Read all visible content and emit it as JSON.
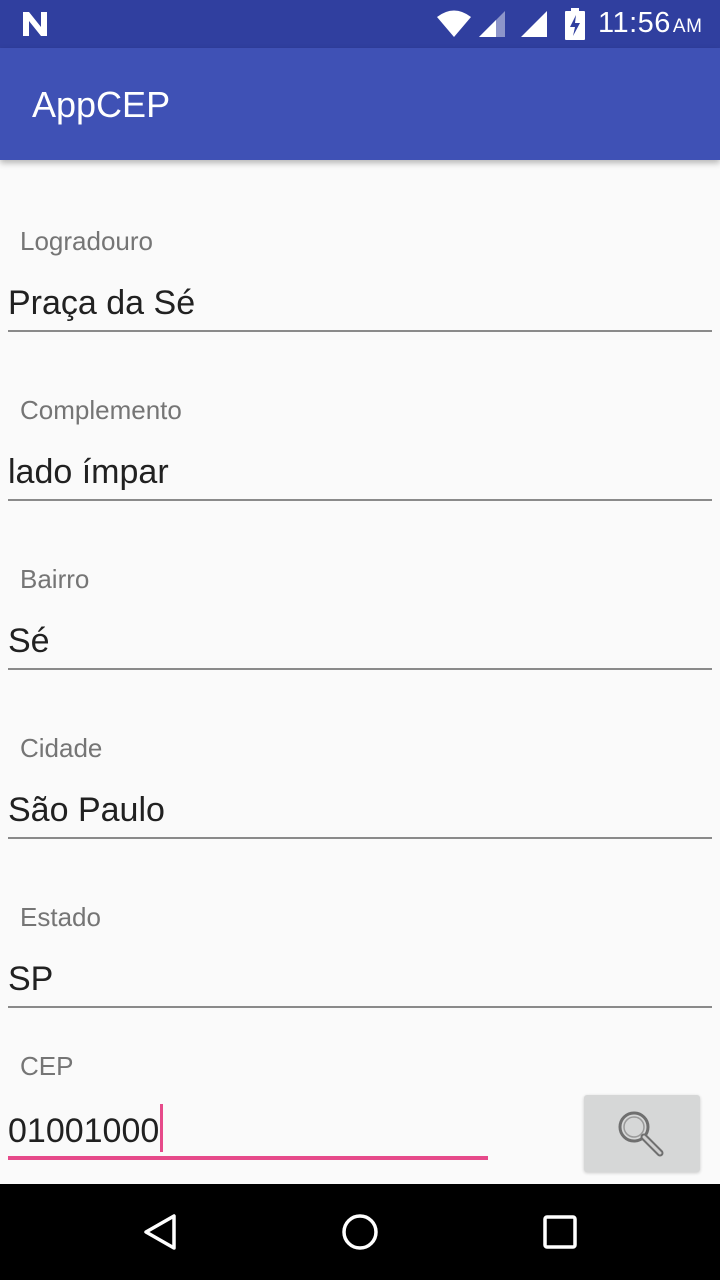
{
  "status_bar": {
    "time": "11:56",
    "ampm": "AM",
    "icons": [
      "n-icon",
      "wifi-icon",
      "signal-icon",
      "signal-icon",
      "battery-charging-icon"
    ]
  },
  "app_bar": {
    "title": "AppCEP"
  },
  "form": {
    "fields": [
      {
        "label": "Logradouro",
        "value": "Praça da Sé"
      },
      {
        "label": "Complemento",
        "value": "lado ímpar"
      },
      {
        "label": "Bairro",
        "value": "Sé"
      },
      {
        "label": "Cidade",
        "value": "São Paulo"
      },
      {
        "label": "Estado",
        "value": "SP"
      }
    ],
    "cep": {
      "label": "CEP",
      "value": "01001000"
    },
    "search_button": {
      "icon": "search-icon"
    }
  },
  "nav_bar": {
    "icons": [
      "back-icon",
      "home-icon",
      "recents-icon"
    ]
  },
  "colors": {
    "status_bar": "#303f9f",
    "app_bar": "#3f51b5",
    "accent": "#e64a8a",
    "background": "#fafafa"
  }
}
